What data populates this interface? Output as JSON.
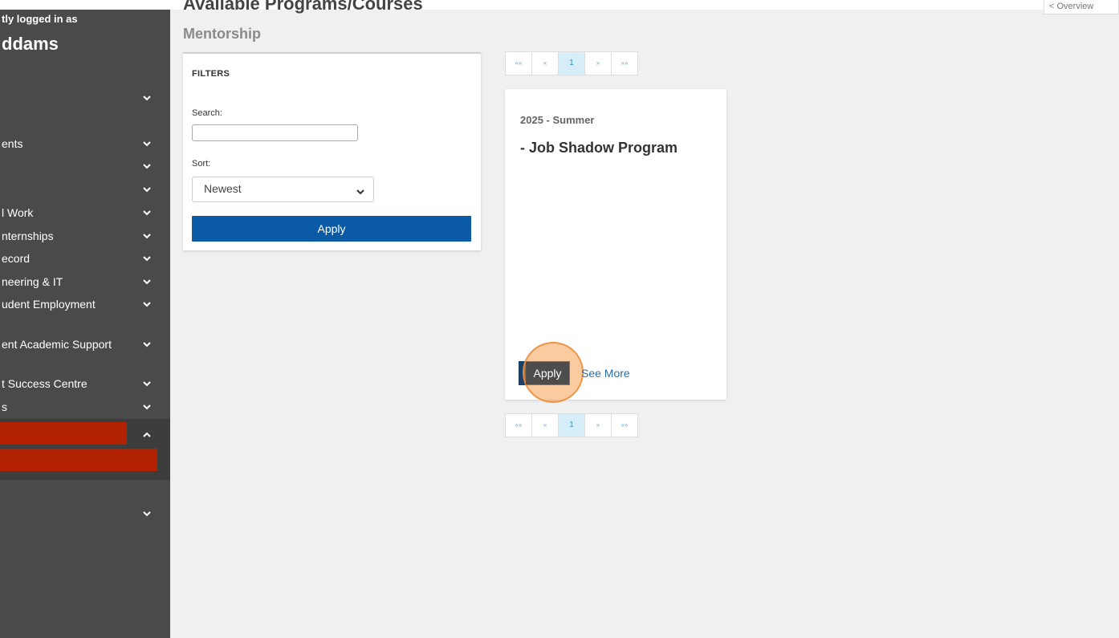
{
  "sidebar": {
    "logged_label": "tly logged in as",
    "user_name": "ddams",
    "items": [
      {
        "label": ""
      },
      {
        "label": "ents"
      },
      {
        "label": ""
      },
      {
        "label": ""
      },
      {
        "label": "l Work"
      },
      {
        "label": "nternships"
      },
      {
        "label": "ecord"
      },
      {
        "label": "neering & IT"
      },
      {
        "label": "udent Employment"
      },
      {
        "label": "ent Academic Support"
      },
      {
        "label": "t Success Centre"
      },
      {
        "label": "s"
      },
      {
        "label": ""
      }
    ],
    "colors": {
      "background": "#4a4a4a",
      "redacted": "#b22200"
    }
  },
  "header": {
    "title": "Available Programs/Courses",
    "subtitle": "Mentorship",
    "overview_label": "< Overview"
  },
  "filters": {
    "title": "FILTERS",
    "search_label": "Search:",
    "search_value": "",
    "sort_label": "Sort:",
    "sort_value": "Newest",
    "apply_label": "Apply"
  },
  "pagination": {
    "first": "««",
    "prev": "«",
    "current": "1",
    "next": "»",
    "last": "»»"
  },
  "program_card": {
    "term": "2025 - Summer",
    "title": "- Job Shadow Program",
    "apply_label": "Apply",
    "see_more_label": "See More"
  }
}
